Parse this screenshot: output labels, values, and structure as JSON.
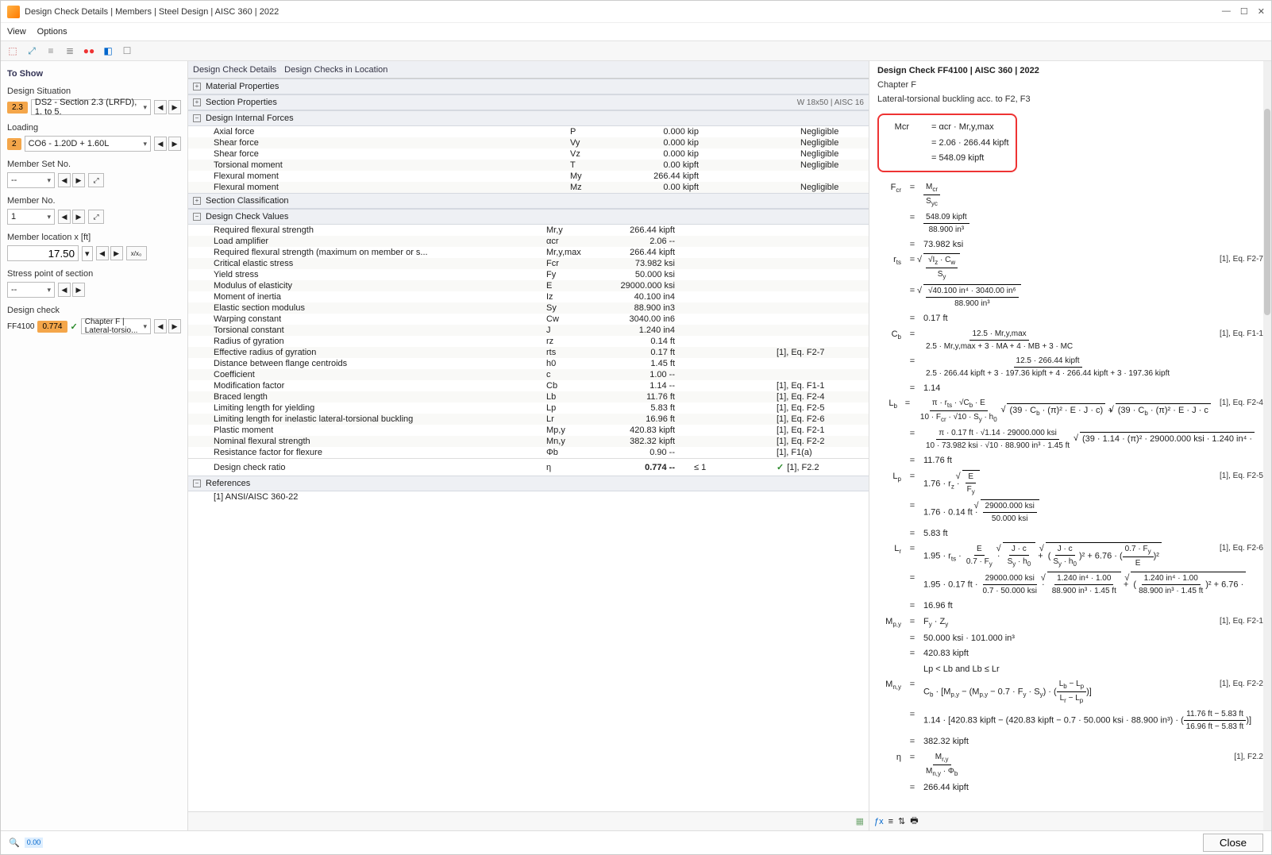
{
  "window": {
    "title": "Design Check Details | Members | Steel Design | AISC 360 | 2022"
  },
  "menu": {
    "view": "View",
    "options": "Options"
  },
  "left": {
    "toshow": "To Show",
    "design_situation_label": "Design Situation",
    "design_situation_badge": "2.3",
    "design_situation_value": "DS2 - Section 2.3 (LRFD), 1. to 5.",
    "loading_label": "Loading",
    "loading_badge": "2",
    "loading_value": "CO6 - 1.20D + 1.60L",
    "member_set_label": "Member Set No.",
    "member_set_value": "-- ",
    "member_no_label": "Member No.",
    "member_no_value": "1",
    "member_loc_label": "Member location x [ft]",
    "member_loc_value": "17.50",
    "stress_point_label": "Stress point of section",
    "stress_point_value": "-- ",
    "design_check_label": "Design check",
    "design_check_code": "FF4100",
    "design_check_ratio": "0.774",
    "design_check_desc": "Chapter F | Lateral-torsio..."
  },
  "center": {
    "tab1": "Design Check Details",
    "tab2": "Design Checks in Location",
    "groups": {
      "mat": "Material Properties",
      "sec": "Section Properties",
      "sec_tag": "W 18x50 | AISC 16",
      "dif": "Design Internal Forces",
      "classif": "Section Classification",
      "dcv": "Design Check Values",
      "refs": "References",
      "ref_item": "[1] ANSI/AISC 360-22"
    },
    "forces": [
      {
        "n": "Axial force",
        "s": "P",
        "v": "0.000 kip",
        "st": "Negligible"
      },
      {
        "n": "Shear force",
        "s": "Vy",
        "v": "0.000 kip",
        "st": "Negligible"
      },
      {
        "n": "Shear force",
        "s": "Vz",
        "v": "0.000 kip",
        "st": "Negligible"
      },
      {
        "n": "Torsional moment",
        "s": "T",
        "v": "0.00 kipft",
        "st": "Negligible"
      },
      {
        "n": "Flexural moment",
        "s": "My",
        "v": "266.44 kipft",
        "st": ""
      },
      {
        "n": "Flexural moment",
        "s": "Mz",
        "v": "0.00 kipft",
        "st": "Negligible"
      }
    ],
    "dcv_rows": [
      {
        "n": "Required flexural strength",
        "s": "Mr,y",
        "v": "266.44 kipft",
        "ref": ""
      },
      {
        "n": "Load amplifier",
        "s": "αcr",
        "v": "2.06 --",
        "ref": ""
      },
      {
        "n": "Required flexural strength (maximum on member or s...",
        "s": "Mr,y,max",
        "v": "266.44 kipft",
        "ref": ""
      },
      {
        "n": "Critical elastic stress",
        "s": "Fcr",
        "v": "73.982 ksi",
        "ref": ""
      },
      {
        "n": "Yield stress",
        "s": "Fy",
        "v": "50.000 ksi",
        "ref": ""
      },
      {
        "n": "Modulus of elasticity",
        "s": "E",
        "v": "29000.000 ksi",
        "ref": ""
      },
      {
        "n": "Moment of inertia",
        "s": "Iz",
        "v": "40.100 in4",
        "ref": ""
      },
      {
        "n": "Elastic section modulus",
        "s": "Sy",
        "v": "88.900 in3",
        "ref": ""
      },
      {
        "n": "Warping constant",
        "s": "Cw",
        "v": "3040.00 in6",
        "ref": ""
      },
      {
        "n": "Torsional constant",
        "s": "J",
        "v": "1.240 in4",
        "ref": ""
      },
      {
        "n": "Radius of gyration",
        "s": "rz",
        "v": "0.14 ft",
        "ref": ""
      },
      {
        "n": "Effective radius of gyration",
        "s": "rts",
        "v": "0.17 ft",
        "ref": "[1], Eq. F2-7"
      },
      {
        "n": "Distance between flange centroids",
        "s": "h0",
        "v": "1.45 ft",
        "ref": ""
      },
      {
        "n": "Coefficient",
        "s": "c",
        "v": "1.00 --",
        "ref": ""
      },
      {
        "n": "Modification factor",
        "s": "Cb",
        "v": "1.14 --",
        "ref": "[1], Eq. F1-1"
      },
      {
        "n": "Braced length",
        "s": "Lb",
        "v": "11.76 ft",
        "ref": "[1], Eq. F2-4"
      },
      {
        "n": "Limiting length for yielding",
        "s": "Lp",
        "v": "5.83 ft",
        "ref": "[1], Eq. F2-5"
      },
      {
        "n": "Limiting length for inelastic lateral-torsional buckling",
        "s": "Lr",
        "v": "16.96 ft",
        "ref": "[1], Eq. F2-6"
      },
      {
        "n": "Plastic moment",
        "s": "Mp,y",
        "v": "420.83 kipft",
        "ref": "[1], Eq. F2-1"
      },
      {
        "n": "Nominal flexural strength",
        "s": "Mn,y",
        "v": "382.32 kipft",
        "ref": "[1], Eq. F2-2"
      },
      {
        "n": "Resistance factor for flexure",
        "s": "Φb",
        "v": "0.90 --",
        "ref": "[1], F1(a)"
      }
    ],
    "final": {
      "n": "Design check ratio",
      "s": "η",
      "v": "0.774 --",
      "lim": "≤ 1",
      "ref": "[1], F2.2"
    }
  },
  "right": {
    "title": "Design Check FF4100 | AISC 360 | 2022",
    "chapter": "Chapter F",
    "desc": "Lateral-torsional buckling acc. to F2, F3",
    "box": {
      "l1a": "Mcr",
      "l1b": "= αcr · Mr,y,max",
      "l2": "= 2.06 · 266.44 kipft",
      "l3": "= 548.09 kipft"
    },
    "fcr_num": "548.09 kipft",
    "fcr_den": "88.900 in³",
    "fcr_res": "73.982 ksi",
    "rts_num": "√40.100 in⁴ · 3040.00 in⁶",
    "rts_den": "88.900 in³",
    "rts_res": "0.17 ft",
    "rts_ref": "[1], Eq. F2-7",
    "cb_num": "12.5 · Mr,y,max",
    "cb_den": "2.5 · Mr,y,max + 3 · MA + 4 · MB + 3 · MC",
    "cb_num2": "12.5 · 266.44 kipft",
    "cb_den2": "2.5 · 266.44 kipft + 3 · 197.36 kipft + 4 · 266.44 kipft + 3 · 197.36 kipft",
    "cb_res": "1.14",
    "cb_ref": "[1], Eq. F1-1",
    "lb_ref": "[1], Eq. F2-4",
    "lb_res": "11.76 ft",
    "lp_ref": "[1], Eq. F2-5",
    "lp_res": "5.83 ft",
    "lr_ref": "[1], Eq. F2-6",
    "lr_res": "16.96 ft",
    "mpy_ref": "[1], Eq. F2-1",
    "mpy_line": "50.000 ksi · 101.000 in³",
    "mpy_res": "420.83 kipft",
    "cond": "Lp < Lb and Lb ≤ Lr",
    "mny_ref": "[1], Eq. F2-2",
    "mny_res": "382.32 kipft",
    "eta_ref": "[1], F2.2",
    "eta_res": "266.44 kipft"
  },
  "footer": {
    "close": "Close"
  }
}
